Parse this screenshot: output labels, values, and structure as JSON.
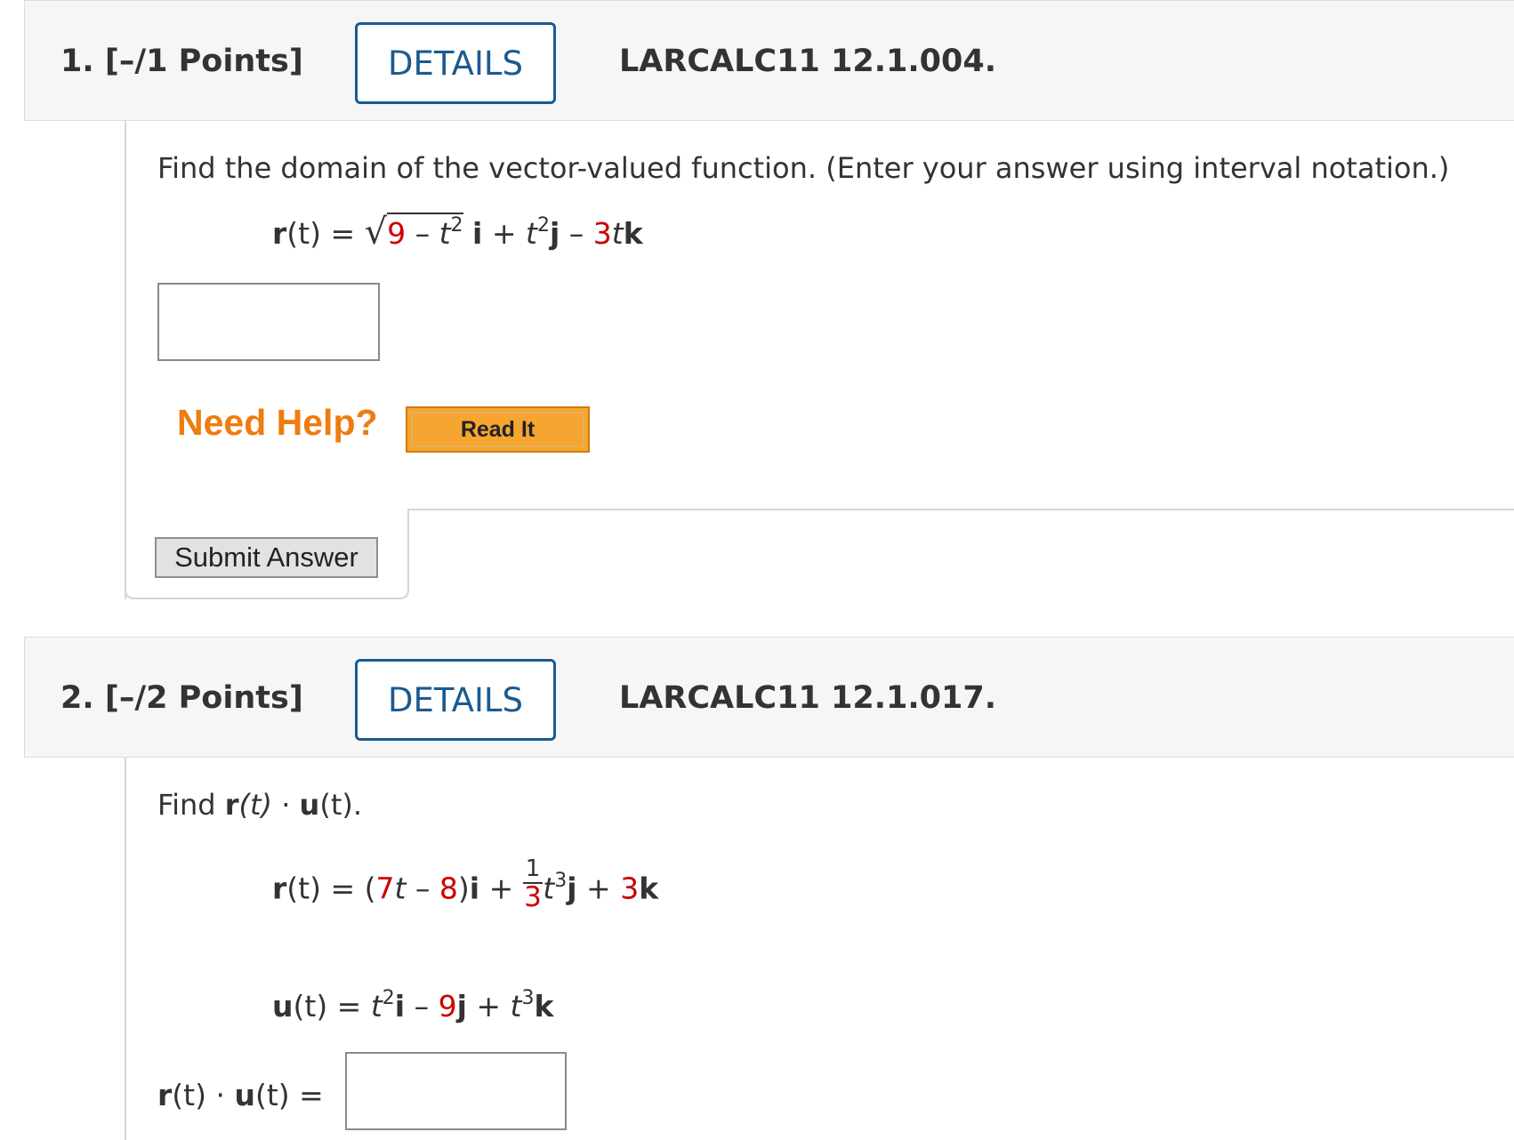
{
  "questions": [
    {
      "number_points": "1.  [–/1 Points]",
      "details_label": "DETAILS",
      "code": "LARCALC11 12.1.004.",
      "prompt": "Find the domain of the vector-valued function. (Enter your answer using interval notation.)",
      "equation": {
        "lhs_var": "r",
        "lhs_arg": "(t) = ",
        "sqrt_const": "9",
        "sqrt_rest": " – ",
        "sqrt_var": "t",
        "sqrt_exp": "2",
        "i_unit": "i",
        "plus": " + ",
        "t2": "t",
        "t2_exp": "2",
        "j_unit": "j",
        "minus": " – ",
        "coef": "3",
        "t3": "t",
        "k_unit": "k"
      },
      "need_help": "Need Help?",
      "read_it": "Read It",
      "submit": "Submit Answer"
    },
    {
      "number_points": "2.  [–/2 Points]",
      "details_label": "DETAILS",
      "code": "LARCALC11 12.1.017.",
      "prompt_prefix": "Find ",
      "prompt_r": "r",
      "prompt_rt": "(t)",
      "prompt_dot": " · ",
      "prompt_u": "u",
      "prompt_ut": "(t).",
      "r_eq": {
        "lhs": "r",
        "lhs_arg": "(t) = (",
        "c1": "7",
        "t": "t",
        "minus": " – ",
        "c2": "8",
        "close": ")",
        "i": "i",
        "plus": " + ",
        "frac_num": "1",
        "frac_den": "3",
        "t3": "t",
        "t3_exp": "3",
        "j": "j",
        "plus2": " + ",
        "c3": "3",
        "k": "k"
      },
      "u_eq": {
        "lhs": "u",
        "lhs_arg": "(t) = ",
        "t": "t",
        "t_exp": "2",
        "i": "i",
        "minus": " – ",
        "c1": "9",
        "j": "j",
        "plus": " + ",
        "t3": "t",
        "t3_exp": "3",
        "k": "k"
      },
      "answer_label_r": "r",
      "answer_label_rt": "(t)",
      "answer_label_dot": " · ",
      "answer_label_u": "u",
      "answer_label_ut": "(t) ="
    }
  ],
  "colors": {
    "header_bg": "#f6f6f6",
    "details_blue": "#1b5a91",
    "need_help_orange": "#ee7c0e",
    "read_it_bg": "#f6a531",
    "red_value": "#cc0000"
  }
}
